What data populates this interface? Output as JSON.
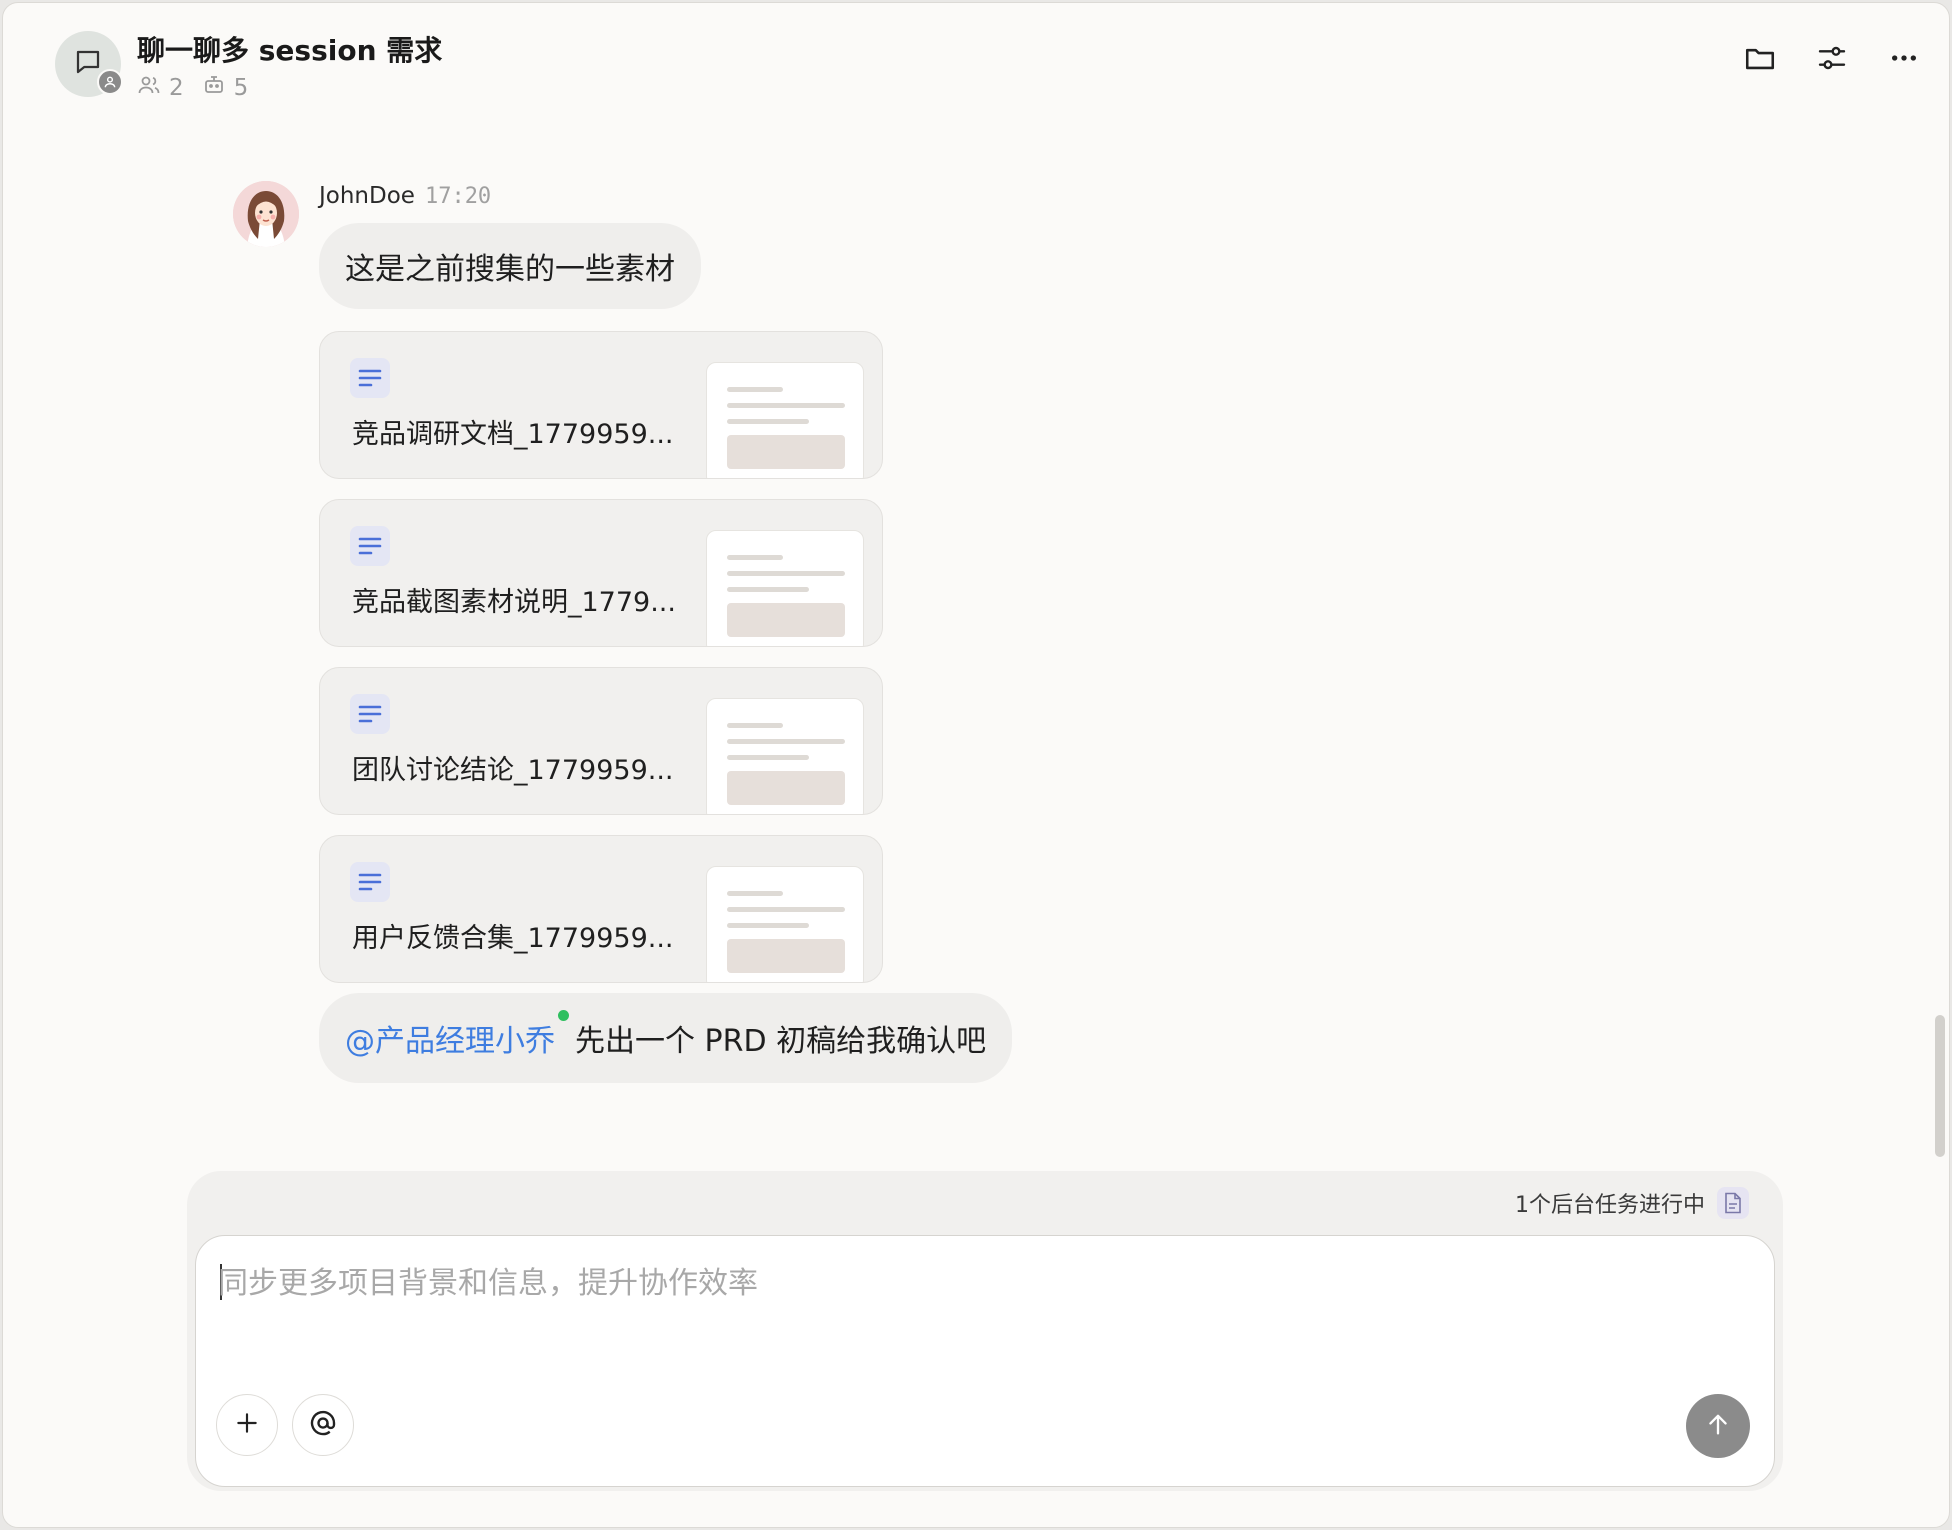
{
  "header": {
    "title": "聊一聊多 session 需求",
    "members_count": "2",
    "bots_count": "5",
    "icons": [
      "chat-icon",
      "group-icon",
      "users-icon",
      "bot-icon",
      "folder-icon",
      "settings-sliders-icon",
      "more-icon"
    ]
  },
  "messages": {
    "sender": "JohnDoe",
    "time": "17:20",
    "text1": "这是之前搜集的一些素材",
    "files": [
      {
        "name": "竞品调研文档_1779959..."
      },
      {
        "name": "竞品截图素材说明_1779..."
      },
      {
        "name": "团队讨论结论_1779959..."
      },
      {
        "name": "用户反馈合集_1779959..."
      }
    ],
    "mention": "@产品经理小乔",
    "text2": "先出一个 PRD 初稿给我确认吧"
  },
  "composer": {
    "status_text": "1个后台任务进行中",
    "placeholder": "同步更多项目背景和信息，提升协作效率",
    "value": ""
  },
  "colors": {
    "accent_mention": "#3e7de0",
    "online_dot": "#2fbf5f",
    "send_button": "#8b8b8b",
    "doc_icon": "#4a6fd8"
  }
}
